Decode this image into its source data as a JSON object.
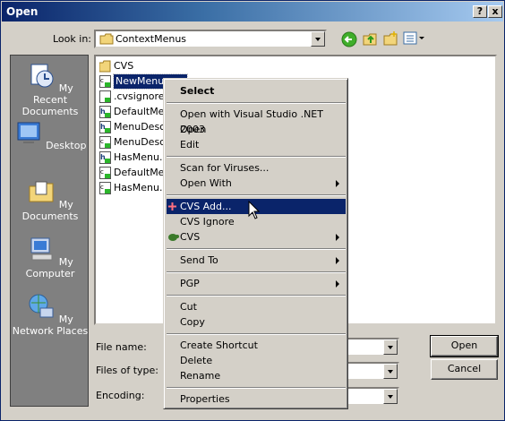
{
  "window": {
    "title": "Open",
    "help_button": "?",
    "close_button": "x"
  },
  "toolbar": {
    "look_in_label": "Look in:",
    "look_in_value": "ContextMenus"
  },
  "places": [
    {
      "label": "My Recent Documents",
      "icon": "recent-documents-icon"
    },
    {
      "label": "Desktop",
      "icon": "desktop-icon"
    },
    {
      "label": "My Documents",
      "icon": "my-documents-icon"
    },
    {
      "label": "My Computer",
      "icon": "my-computer-icon"
    },
    {
      "label": "My Network Places",
      "icon": "network-places-icon"
    }
  ],
  "files": [
    {
      "name": "CVS",
      "icon": "folder-icon"
    },
    {
      "name": "NewMenu.cpp",
      "icon": "cpp-file-icon"
    },
    {
      "name": ".cvsignore",
      "icon": "text-file-icon"
    },
    {
      "name": "DefaultMenu",
      "icon": "header-file-icon"
    },
    {
      "name": "MenuDescripti",
      "icon": "header-file-icon"
    },
    {
      "name": "MenuDescripti",
      "icon": "cpp-file-icon"
    },
    {
      "name": "HasMenu.h",
      "icon": "header-file-icon"
    },
    {
      "name": "DefaultMenu",
      "icon": "cpp-file-icon"
    },
    {
      "name": "HasMenu.cp",
      "icon": "cpp-file-icon"
    }
  ],
  "form": {
    "file_name_label": "File name:",
    "files_of_type_label": "Files of type:",
    "encoding_label": "Encoding:",
    "open_button": "Open",
    "cancel_button": "Cancel"
  },
  "context_menu": {
    "select": "Select",
    "open_with_vs": "Open with Visual Studio .NET 2003",
    "open": "Open",
    "edit": "Edit",
    "scan_for_viruses": "Scan for Viruses...",
    "open_with": "Open With",
    "cvs_add": "CVS Add...",
    "cvs_ignore": "CVS Ignore",
    "cvs": "CVS",
    "send_to": "Send To",
    "pgp": "PGP",
    "cut": "Cut",
    "copy": "Copy",
    "create_shortcut": "Create Shortcut",
    "delete": "Delete",
    "rename": "Rename",
    "properties": "Properties"
  },
  "colors": {
    "titlebar": "#0a246a",
    "highlight": "#0a246a",
    "face": "#d4d0c8"
  }
}
